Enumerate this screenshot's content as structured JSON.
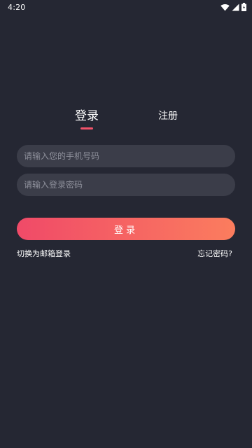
{
  "status_bar": {
    "time": "4:20",
    "icons": [
      "wifi-icon",
      "signal-icon",
      "battery-icon"
    ]
  },
  "tabs": {
    "login_label": "登录",
    "register_label": "注册",
    "active": "login"
  },
  "form": {
    "phone_placeholder": "请输入您的手机号码",
    "phone_value": "",
    "password_placeholder": "请输入登录密码",
    "password_value": ""
  },
  "login_button_label": "登录",
  "links": {
    "switch_email": "切换为邮箱登录",
    "forgot_password": "忘记密码?"
  },
  "colors": {
    "background": "#252733",
    "input_background": "#3b3d49",
    "accent_start": "#f04a68",
    "accent_end": "#fb7d5e",
    "tab_indicator": "#f2536a"
  }
}
